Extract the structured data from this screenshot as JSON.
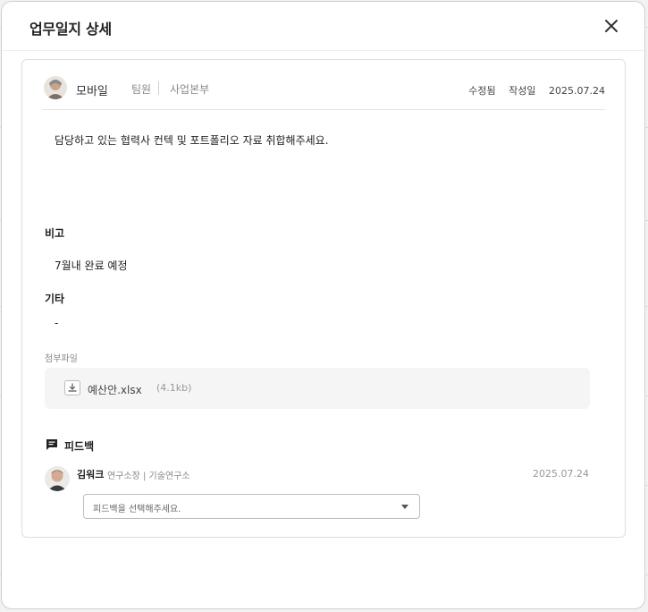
{
  "modal": {
    "title": "업무일지 상세",
    "close_icon": "close-icon"
  },
  "author": {
    "name": "모바일",
    "role": "팀원",
    "department": "사업본부",
    "status": "수정됨",
    "date_label": "작성일",
    "date": "2025.07.24"
  },
  "content": {
    "text": "담당하고 있는 협력사 컨텍 및 포트폴리오 자료 취합해주세요."
  },
  "remarks": {
    "label": "비고",
    "value": "7월내 완료 예정"
  },
  "etc": {
    "label": "기타",
    "value": "-"
  },
  "attachments": {
    "label": "첨부파일",
    "files": [
      {
        "name": "예산안.xlsx",
        "size": "(4.1kb)"
      }
    ]
  },
  "feedback": {
    "title": "피드백",
    "reviewer": {
      "name": "김워크",
      "role": "연구소장 | 기술연구소",
      "date": "2025.07.24"
    },
    "select_placeholder": "피드백을 선택해주세요."
  }
}
